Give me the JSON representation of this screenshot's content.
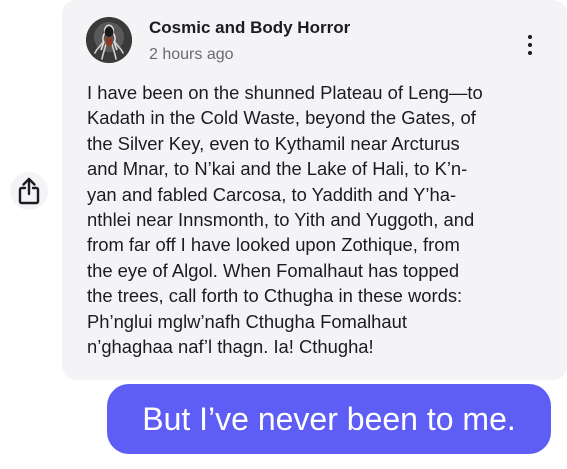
{
  "post": {
    "group_name": "Cosmic and Body Horror",
    "timestamp": "2 hours ago",
    "avatar_icon": "tentacled-figure-avatar",
    "more_icon": "vertical-ellipsis-icon",
    "body": "I have been on the shunned Plateau of Leng—to\nKadath in the Cold Waste, beyond the Gates, of\nthe Silver Key, even to Kythamil near Arcturus\nand Mnar, to N’kai and the Lake of Hali, to K’n-\nyan and fabled Carcosa, to Yaddith and Y’ha-\nnthlei near Innsmonth, to Yith and Yuggoth, and\nfrom far off I have looked upon Zothique, from\nthe eye of Algol. When Fomalhaut has topped\nthe trees, call forth to Cthugha in these words:\nPh’nglui mglw’nafh Cthugha Fomalhaut\nn’ghaghaa naf’l thagn. Ia! Cthugha!"
  },
  "share": {
    "icon": "share-icon"
  },
  "reply": {
    "text": "But I’ve never been to me."
  },
  "colors": {
    "accent": "#5e5ef6",
    "card_background": "#f4f4f6",
    "secondary_text": "#6b6b70"
  }
}
